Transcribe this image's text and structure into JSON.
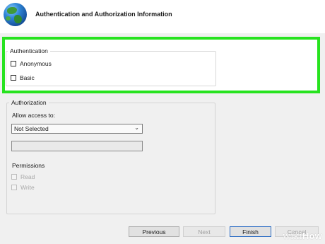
{
  "header": {
    "title": "Authentication and Authorization Information"
  },
  "authentication": {
    "legend": "Authentication",
    "options": [
      {
        "label": "Anonymous",
        "checked": false
      },
      {
        "label": "Basic",
        "checked": false
      }
    ]
  },
  "authorization": {
    "legend": "Authorization",
    "allow_label": "Allow access to:",
    "allow_selected": "Not Selected",
    "text_value": "",
    "permissions_label": "Permissions",
    "permissions": [
      {
        "label": "Read",
        "checked": false,
        "enabled": false
      },
      {
        "label": "Write",
        "checked": false,
        "enabled": false
      }
    ]
  },
  "buttons": {
    "previous": "Previous",
    "next": "Next",
    "finish": "Finish",
    "cancel": "Cancel"
  },
  "watermark": {
    "wiki": "wiki",
    "how": "How"
  },
  "colors": {
    "highlight": "#27e31f",
    "finish_border": "#2b6cc4"
  },
  "icons": {
    "app": "globe-icon"
  }
}
